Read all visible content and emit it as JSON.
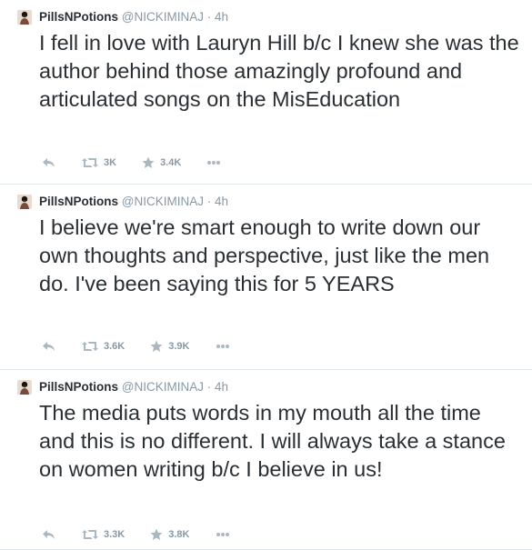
{
  "tweets": [
    {
      "fullname": "PillsNPotions",
      "handle": "@NICKIMINAJ",
      "separator": "·",
      "time": "4h",
      "text": "I fell in love with Lauryn Hill b/c I knew she was the author behind those amazingly profound and articulated songs on the MisEducation",
      "retweets": "3K",
      "favorites": "3.4K"
    },
    {
      "fullname": "PillsNPotions",
      "handle": "@NICKIMINAJ",
      "separator": "·",
      "time": "4h",
      "text": "I believe we're smart enough to write down our own thoughts and perspective, just like the men do. I've been saying this for 5 YEARS",
      "retweets": "3.6K",
      "favorites": "3.9K"
    },
    {
      "fullname": "PillsNPotions",
      "handle": "@NICKIMINAJ",
      "separator": "·",
      "time": "4h",
      "text": "The media puts words in my mouth all the time and this is no different. I will always take a stance on women writing b/c I believe in us!",
      "retweets": "3.3K",
      "favorites": "3.8K"
    }
  ],
  "icons": {
    "reply": "reply-icon",
    "retweet": "retweet-icon",
    "favorite": "star-icon",
    "more": "more-icon"
  },
  "colors": {
    "text": "#292f33",
    "muted": "#8899a6",
    "divider": "#e1e8ed"
  }
}
